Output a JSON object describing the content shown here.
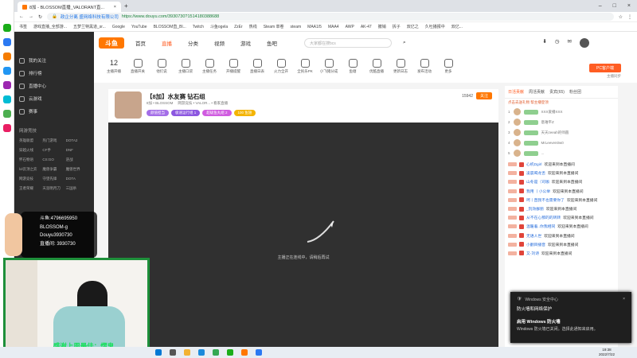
{
  "browser": {
    "tab_title": "8加 - BLOSSOM直播_VALORANT直...",
    "url_security": "政企分离 盛网络科技有限公司",
    "url": "https://www.douyu.com/3930730?1514180388688",
    "bookmarks": [
      "书签",
      "游戏直播_全部游...",
      "五梦兰特黑道_sr...",
      "Google",
      "YouTube",
      "BLOSSOM直_Bl...",
      "Twitch",
      "斗鱼ogela",
      "ZzEr",
      "热线",
      "Steam 单卷",
      "steam",
      "MAA1/5",
      "MAA4",
      "AWP",
      "AK-47",
      "撤销",
      "拆子",
      "双亿之",
      "久吐播报中",
      "双亿..."
    ]
  },
  "topnav": {
    "logo": "斗鱼",
    "items": [
      "首页",
      "直播",
      "分类",
      "视频",
      "游戏",
      "鱼吧"
    ],
    "search_placeholder": "大家都在搜bcs"
  },
  "iconbar": {
    "count": "12",
    "items": [
      "主播开播",
      "直播开关",
      "他们说",
      "主播口袋",
      "主播任务",
      "开播提醒",
      "直播日表",
      "火力全开",
      "全民乐PK",
      "小飞猪分成",
      "鱼塘",
      "优酷直播",
      "更新日志",
      "发布活动",
      "更多"
    ],
    "pc_button": "PC客户端",
    "pc_sub": "主播同步"
  },
  "sidebar": {
    "nav": [
      "我的关注",
      "排行榜",
      "直播中心",
      "云游戏",
      "赛事"
    ],
    "section": "网游竞技",
    "categories": [
      "英雄联盟",
      "热门游戏",
      "DOTA2",
      "穿越火线",
      "CF手",
      "DNF",
      "怀石物语",
      "CS:GO",
      "逆战",
      "lol云顶之弈",
      "魔兽争霸",
      "魔兽世界",
      "网游竞技",
      "守望先锋",
      "DOTA",
      "王者荣耀",
      "天涯明月刀",
      "三国杀"
    ]
  },
  "room": {
    "title": "【8加】水友赛 钻石组",
    "anchor": "8加 • BLOSSOM",
    "category": "网游竞技 • VALOR... • 看家直播",
    "follow_label": "关注",
    "followers": "15942",
    "tags": [
      "颜值担当",
      "极速运行组 1",
      "超级鱼丸组 2",
      "100 鱼翅"
    ],
    "loading_text": "主播正在连线中，请稍后再试"
  },
  "chat": {
    "tabs": [
      "日活贡献",
      "周活贡献",
      "贵宾(65)",
      "粉丝团"
    ],
    "rank_header": "点击去送礼物 帮主播登顶",
    "ranks": [
      {
        "pos": "1",
        "name": "XXX爱播XXX"
      },
      {
        "pos": "2",
        "name": "意难平Z"
      },
      {
        "pos": "3",
        "name": "天天zeeah的师圆"
      },
      {
        "pos": "4",
        "name": "MrLeeven0w0"
      },
      {
        "pos": "5",
        "name": "..."
      }
    ],
    "messages": [
      {
        "nick": "心机Dgirl",
        "text": "欢迎来到本直播间"
      },
      {
        "nick": "凌晨喝龙舌",
        "text": "欢迎来到本直播间"
      },
      {
        "nick": "山冬是（司咖",
        "text": "欢迎来到本直播间"
      },
      {
        "nick": "我用 丨小公举",
        "text": "欢迎来到本直播间"
      },
      {
        "nick": "呵丨直我不也需要你了",
        "text": "欢迎来到本直播间"
      },
      {
        "nick": "_阮效群丽",
        "text": "欢迎来到本直播间"
      },
      {
        "nick": "从不在心那的的转转",
        "text": "欢迎来到本直播间"
      },
      {
        "nick": "温暖着..你我相同",
        "text": "欢迎来到本直播间"
      },
      {
        "nick": "无语人世",
        "text": "欢迎来到本直播间"
      },
      {
        "nick": "小翻目播音",
        "text": "欢迎来到本直播间"
      },
      {
        "nick": "又-刘诗",
        "text": "欢迎来到本直播间"
      }
    ]
  },
  "overlay": {
    "cam_lines": [
      "斗鱼:4796695950",
      "BLOSSOM-g",
      "Douyu3930730",
      "直播间: 3930730"
    ],
    "banner": "感谢上周最佳：熠鬼"
  },
  "toast": {
    "source": "Windows 安全中心",
    "title": "防火墙和网络保护",
    "heading": "启用 Windows 防火墙",
    "body": "Windows 防火墙已关闭。选择此通知来启用。"
  },
  "clock": {
    "time": "19:38",
    "date": "2022/7/22"
  },
  "colors": {
    "accent": "#ff5d23",
    "green": "#1e8f3a"
  }
}
